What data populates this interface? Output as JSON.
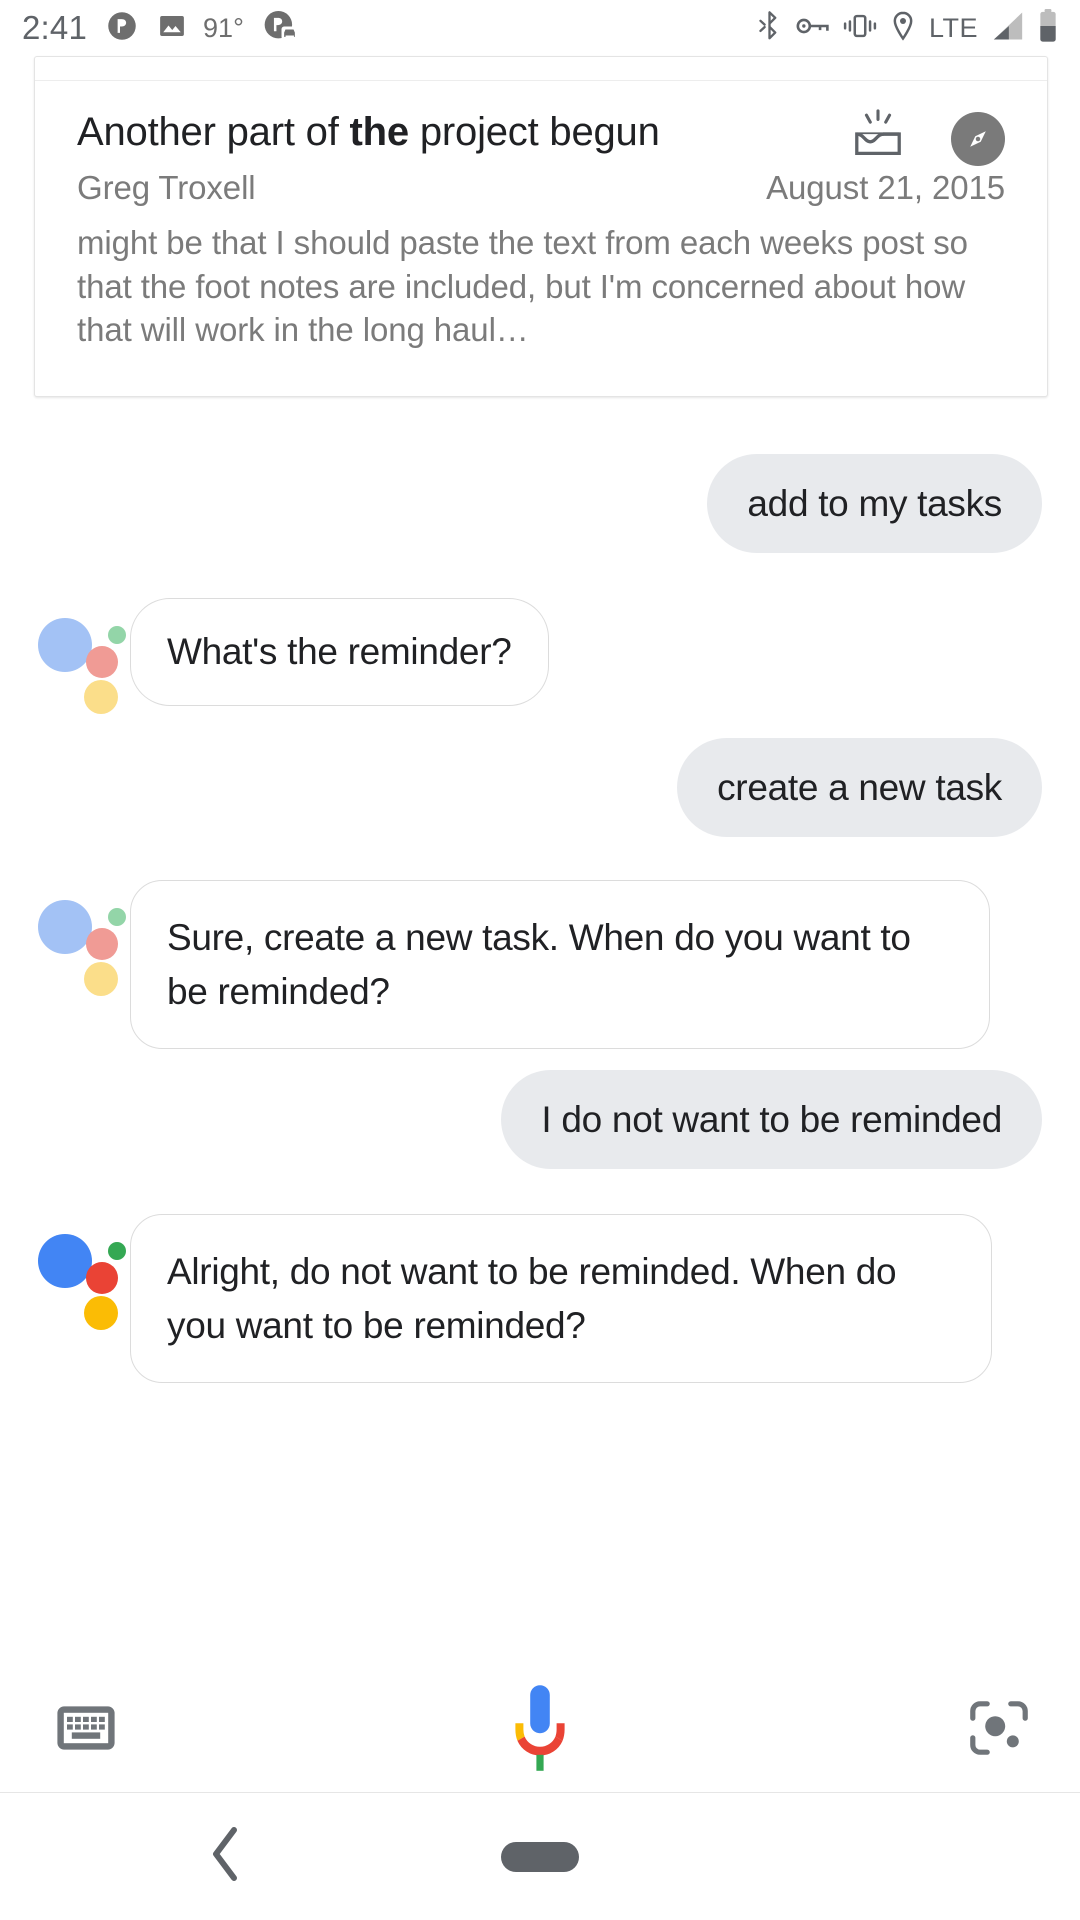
{
  "status_bar": {
    "clock": "2:41",
    "temperature": "91°",
    "network_label": "LTE",
    "left_icons": [
      "pushbullet-icon",
      "image-icon",
      "pushbullet-car-icon"
    ],
    "right_icons": [
      "bluetooth-icon",
      "vpn-key-icon",
      "vibrate-icon",
      "location-pin-icon",
      "signal-bars-icon",
      "battery-icon"
    ]
  },
  "email_card": {
    "title_before": "Another part of ",
    "title_bold": "the",
    "title_after": " project begun",
    "sender": "Greg Troxell",
    "date": "August 21, 2015",
    "snippet": "might be that I should paste the text from each weeks post so that the foot notes are included, but I'm concerned about how that will work in the long haul…",
    "icons": [
      "open-inbox-icon",
      "explore-compass-icon"
    ]
  },
  "conversation": [
    {
      "role": "user",
      "text": "add to my tasks"
    },
    {
      "role": "assistant",
      "text": "What's the reminder?",
      "logo": "faded"
    },
    {
      "role": "user",
      "text": "create a new task"
    },
    {
      "role": "assistant",
      "text": "Sure, create a new task. When do you want to be reminded?",
      "logo": "faded"
    },
    {
      "role": "user",
      "text": "I do not want to be reminded"
    },
    {
      "role": "assistant",
      "text": "Alright, do not want to be reminded. When do you want to be reminded?",
      "logo": "full"
    }
  ],
  "toolbar": {
    "keyboard_label": "keyboard-icon",
    "mic_label": "google-mic-icon",
    "lens_label": "google-lens-icon"
  },
  "nav_bar": {
    "back_label": "back-icon",
    "home_label": "home-pill"
  },
  "colors": {
    "google_blue": "#4285F4",
    "google_red": "#EA4335",
    "google_yellow": "#FBBC05",
    "google_green": "#34A853",
    "faded_blue": "#A3C2F5",
    "faded_red": "#F09B95",
    "faded_yellow": "#FBDE8A",
    "faded_green": "#93D5A8",
    "user_bubble_bg": "#E8EAED",
    "icon_grey": "#70757A"
  }
}
